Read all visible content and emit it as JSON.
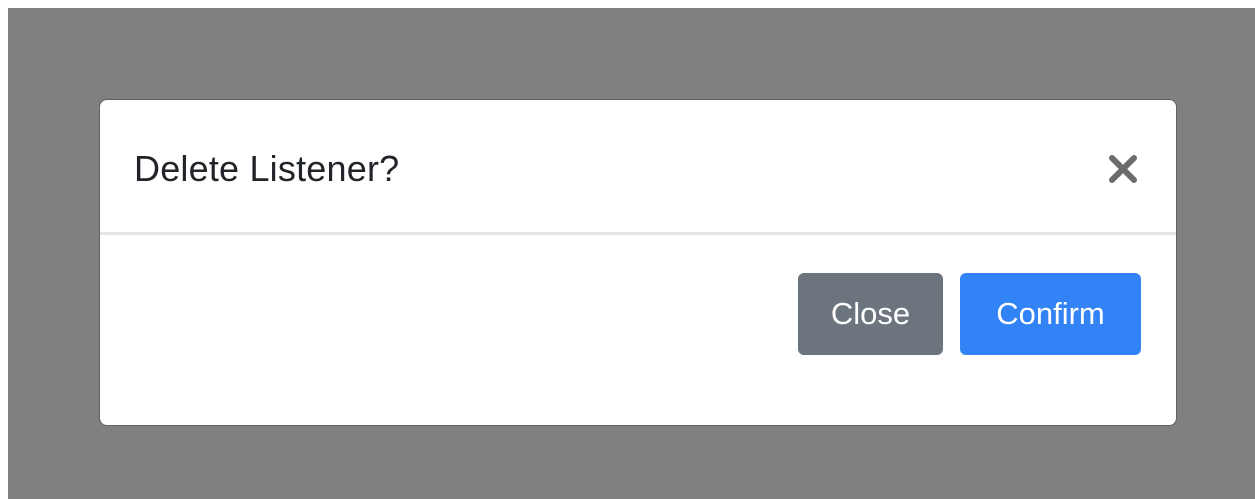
{
  "dialog": {
    "title": "Delete Listener?",
    "close_icon": "close-x-icon",
    "buttons": {
      "close_label": "Close",
      "confirm_label": "Confirm"
    }
  },
  "colors": {
    "backdrop": "#808080",
    "secondary_button": "#6c757d",
    "primary_button": "#3283f6",
    "title_text": "#212529",
    "close_icon": "#6c6c6c"
  }
}
